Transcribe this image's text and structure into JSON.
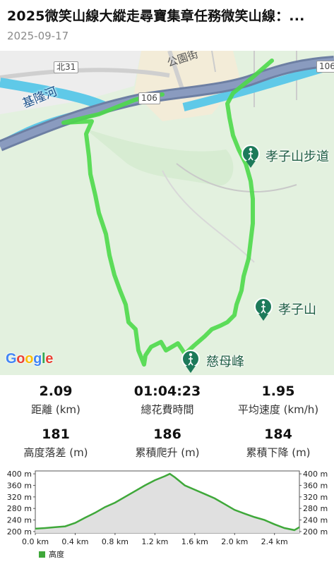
{
  "header": {
    "title": "2025微笑山線大縱走尋寶集章任務微笑山線：...",
    "date": "2025-09-17"
  },
  "map": {
    "route_color": "#4cd94a",
    "river_label": "基隆河",
    "place_label": "公園街",
    "road_labels": [
      "北31",
      "106",
      "106"
    ],
    "poi": [
      {
        "label": "孝子山步道",
        "icon": "hiker-pin-icon"
      },
      {
        "label": "孝子山",
        "icon": "hiker-pin-icon"
      },
      {
        "label": "慈母峰",
        "icon": "hiker-pin-icon"
      }
    ],
    "attribution": "Google"
  },
  "stats": [
    {
      "value": "2.09",
      "label": "距離 (km)"
    },
    {
      "value": "01:04:23",
      "label": "總花費時間"
    },
    {
      "value": "1.95",
      "label": "平均速度 (km/h)"
    },
    {
      "value": "181",
      "label": "高度落差 (m)"
    },
    {
      "value": "186",
      "label": "累積爬升 (m)"
    },
    {
      "value": "184",
      "label": "累積下降 (m)"
    }
  ],
  "chart_data": {
    "type": "area",
    "x": [
      0.0,
      0.1,
      0.2,
      0.3,
      0.4,
      0.5,
      0.6,
      0.7,
      0.8,
      0.9,
      1.0,
      1.1,
      1.2,
      1.3,
      1.35,
      1.4,
      1.5,
      1.6,
      1.7,
      1.8,
      1.9,
      2.0,
      2.1,
      2.2,
      2.3,
      2.4,
      2.5,
      2.6,
      2.65
    ],
    "y": [
      210,
      212,
      215,
      218,
      230,
      248,
      265,
      285,
      300,
      320,
      340,
      360,
      378,
      392,
      400,
      388,
      360,
      345,
      330,
      315,
      295,
      275,
      262,
      250,
      240,
      225,
      212,
      205,
      215
    ],
    "xlim": [
      0.0,
      2.65
    ],
    "ylim": [
      195,
      410
    ],
    "x_ticks": [
      "0.0 km",
      "0.4 km",
      "0.8 km",
      "1.2 km",
      "1.6 km",
      "2.0 km",
      "2.4 km"
    ],
    "x_tick_values": [
      0.0,
      0.4,
      0.8,
      1.2,
      1.6,
      2.0,
      2.4
    ],
    "y_ticks": [
      "400 m",
      "360 m",
      "320 m",
      "280 m",
      "240 m",
      "200 m"
    ],
    "y_tick_values": [
      400,
      360,
      320,
      280,
      240,
      200
    ],
    "line_color": "#3fa83a",
    "fill_color": "#e0e0e0",
    "grid": false,
    "series": [
      {
        "name": "高度"
      }
    ]
  }
}
